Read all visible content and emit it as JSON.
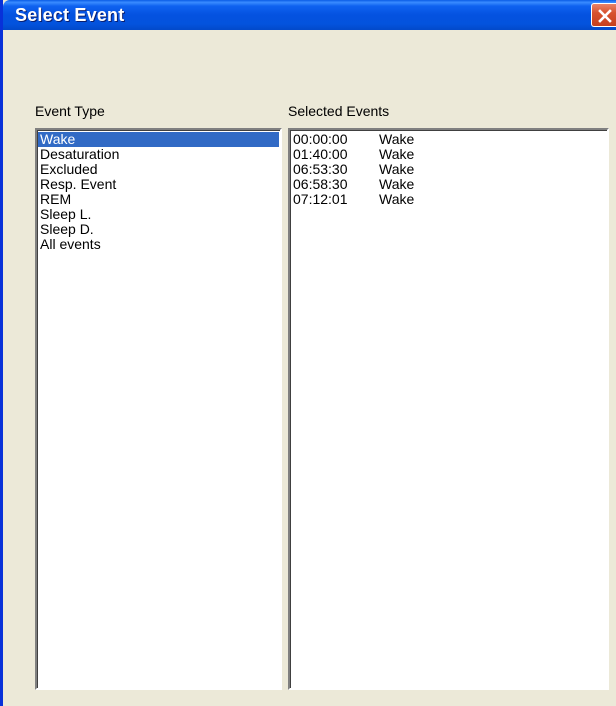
{
  "window": {
    "title": "Select Event"
  },
  "event_type": {
    "label": "Event Type",
    "items": [
      {
        "label": "Wake",
        "selected": true
      },
      {
        "label": "Desaturation",
        "selected": false
      },
      {
        "label": "Excluded",
        "selected": false
      },
      {
        "label": "Resp. Event",
        "selected": false
      },
      {
        "label": "REM",
        "selected": false
      },
      {
        "label": "Sleep L.",
        "selected": false
      },
      {
        "label": "Sleep D.",
        "selected": false
      },
      {
        "label": "All events",
        "selected": false
      }
    ]
  },
  "selected_events": {
    "label": "Selected Events",
    "rows": [
      {
        "time": "00:00:00",
        "type": "Wake"
      },
      {
        "time": "01:40:00",
        "type": "Wake"
      },
      {
        "time": "06:53:30",
        "type": "Wake"
      },
      {
        "time": "06:58:30",
        "type": "Wake"
      },
      {
        "time": "07:12:01",
        "type": "Wake"
      }
    ]
  },
  "colors": {
    "titlebar": "#0452E0",
    "selection": "#316AC5",
    "dialog_bg": "#ECE9D8",
    "close_button": "#D8532F"
  },
  "icons": {
    "close": "close-icon"
  }
}
